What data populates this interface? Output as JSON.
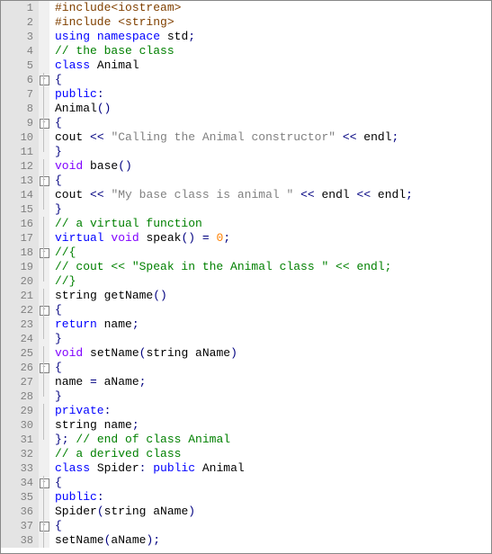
{
  "lines": [
    {
      "n": 1,
      "fold": "",
      "tokens": [
        [
          "preproc",
          "#include<iostream>"
        ]
      ]
    },
    {
      "n": 2,
      "fold": "",
      "tokens": [
        [
          "preproc",
          "#include <string>"
        ]
      ]
    },
    {
      "n": 3,
      "fold": "",
      "tokens": [
        [
          "keyword",
          "using"
        ],
        [
          "plain",
          " "
        ],
        [
          "keyword",
          "namespace"
        ],
        [
          "plain",
          " std"
        ],
        [
          "punct",
          ";"
        ]
      ]
    },
    {
      "n": 4,
      "fold": "",
      "tokens": [
        [
          "comment",
          "// the base class"
        ]
      ]
    },
    {
      "n": 5,
      "fold": "",
      "tokens": [
        [
          "keyword",
          "class"
        ],
        [
          "plain",
          " Animal"
        ]
      ]
    },
    {
      "n": 6,
      "fold": "box",
      "tokens": [
        [
          "punct",
          "{"
        ]
      ]
    },
    {
      "n": 7,
      "fold": "line",
      "tokens": [
        [
          "keyword",
          "public"
        ],
        [
          "punct",
          ":"
        ]
      ]
    },
    {
      "n": 8,
      "fold": "line",
      "tokens": [
        [
          "plain",
          "Animal"
        ],
        [
          "punct",
          "()"
        ]
      ]
    },
    {
      "n": 9,
      "fold": "box",
      "tokens": [
        [
          "punct",
          "{"
        ]
      ]
    },
    {
      "n": 10,
      "fold": "line",
      "tokens": [
        [
          "plain",
          "cout "
        ],
        [
          "punct",
          "<<"
        ],
        [
          "plain",
          " "
        ],
        [
          "string",
          "\"Calling the Animal constructor\""
        ],
        [
          "plain",
          " "
        ],
        [
          "punct",
          "<<"
        ],
        [
          "plain",
          " endl"
        ],
        [
          "punct",
          ";"
        ]
      ]
    },
    {
      "n": 11,
      "fold": "end",
      "tokens": [
        [
          "punct",
          "}"
        ]
      ]
    },
    {
      "n": 12,
      "fold": "line",
      "tokens": [
        [
          "type",
          "void"
        ],
        [
          "plain",
          " base"
        ],
        [
          "punct",
          "()"
        ]
      ]
    },
    {
      "n": 13,
      "fold": "box",
      "tokens": [
        [
          "punct",
          "{"
        ]
      ]
    },
    {
      "n": 14,
      "fold": "line",
      "tokens": [
        [
          "plain",
          "cout "
        ],
        [
          "punct",
          "<<"
        ],
        [
          "plain",
          " "
        ],
        [
          "string",
          "\"My base class is animal \""
        ],
        [
          "plain",
          " "
        ],
        [
          "punct",
          "<<"
        ],
        [
          "plain",
          " endl "
        ],
        [
          "punct",
          "<<"
        ],
        [
          "plain",
          " endl"
        ],
        [
          "punct",
          ";"
        ]
      ]
    },
    {
      "n": 15,
      "fold": "end",
      "tokens": [
        [
          "punct",
          "}"
        ]
      ]
    },
    {
      "n": 16,
      "fold": "line",
      "tokens": [
        [
          "comment",
          "// a virtual function"
        ]
      ]
    },
    {
      "n": 17,
      "fold": "line",
      "tokens": [
        [
          "keyword",
          "virtual"
        ],
        [
          "plain",
          " "
        ],
        [
          "type",
          "void"
        ],
        [
          "plain",
          " speak"
        ],
        [
          "punct",
          "()"
        ],
        [
          "plain",
          " "
        ],
        [
          "punct",
          "="
        ],
        [
          "plain",
          " "
        ],
        [
          "number",
          "0"
        ],
        [
          "punct",
          ";"
        ]
      ]
    },
    {
      "n": 18,
      "fold": "box",
      "tokens": [
        [
          "comment",
          "//{"
        ]
      ]
    },
    {
      "n": 19,
      "fold": "line",
      "tokens": [
        [
          "comment",
          "// cout << \"Speak in the Animal class \" << endl;"
        ]
      ]
    },
    {
      "n": 20,
      "fold": "end",
      "tokens": [
        [
          "comment",
          "//}"
        ]
      ]
    },
    {
      "n": 21,
      "fold": "line",
      "tokens": [
        [
          "plain",
          "string getName"
        ],
        [
          "punct",
          "()"
        ]
      ]
    },
    {
      "n": 22,
      "fold": "box",
      "tokens": [
        [
          "punct",
          "{"
        ]
      ]
    },
    {
      "n": 23,
      "fold": "line",
      "tokens": [
        [
          "keyword",
          "return"
        ],
        [
          "plain",
          " name"
        ],
        [
          "punct",
          ";"
        ]
      ]
    },
    {
      "n": 24,
      "fold": "end",
      "tokens": [
        [
          "punct",
          "}"
        ]
      ]
    },
    {
      "n": 25,
      "fold": "line",
      "tokens": [
        [
          "type",
          "void"
        ],
        [
          "plain",
          " setName"
        ],
        [
          "punct",
          "("
        ],
        [
          "plain",
          "string aName"
        ],
        [
          "punct",
          ")"
        ]
      ]
    },
    {
      "n": 26,
      "fold": "box",
      "tokens": [
        [
          "punct",
          "{"
        ]
      ]
    },
    {
      "n": 27,
      "fold": "line",
      "tokens": [
        [
          "plain",
          "name "
        ],
        [
          "punct",
          "="
        ],
        [
          "plain",
          " aName"
        ],
        [
          "punct",
          ";"
        ]
      ]
    },
    {
      "n": 28,
      "fold": "end",
      "tokens": [
        [
          "punct",
          "}"
        ]
      ]
    },
    {
      "n": 29,
      "fold": "line",
      "tokens": [
        [
          "keyword",
          "private"
        ],
        [
          "punct",
          ":"
        ]
      ]
    },
    {
      "n": 30,
      "fold": "line",
      "tokens": [
        [
          "plain",
          "string name"
        ],
        [
          "punct",
          ";"
        ]
      ]
    },
    {
      "n": 31,
      "fold": "end",
      "tokens": [
        [
          "punct",
          "};"
        ],
        [
          "plain",
          " "
        ],
        [
          "comment",
          "// end of class Animal"
        ]
      ]
    },
    {
      "n": 32,
      "fold": "",
      "tokens": [
        [
          "comment",
          "// a derived class"
        ]
      ]
    },
    {
      "n": 33,
      "fold": "",
      "tokens": [
        [
          "keyword",
          "class"
        ],
        [
          "plain",
          " Spider"
        ],
        [
          "punct",
          ":"
        ],
        [
          "plain",
          " "
        ],
        [
          "keyword",
          "public"
        ],
        [
          "plain",
          " Animal"
        ]
      ]
    },
    {
      "n": 34,
      "fold": "box",
      "tokens": [
        [
          "punct",
          "{"
        ]
      ]
    },
    {
      "n": 35,
      "fold": "line",
      "tokens": [
        [
          "keyword",
          "public"
        ],
        [
          "punct",
          ":"
        ]
      ]
    },
    {
      "n": 36,
      "fold": "line",
      "tokens": [
        [
          "plain",
          "Spider"
        ],
        [
          "punct",
          "("
        ],
        [
          "plain",
          "string aName"
        ],
        [
          "punct",
          ")"
        ]
      ]
    },
    {
      "n": 37,
      "fold": "box",
      "tokens": [
        [
          "punct",
          "{"
        ]
      ]
    },
    {
      "n": 38,
      "fold": "line",
      "tokens": [
        [
          "plain",
          "setName"
        ],
        [
          "punct",
          "("
        ],
        [
          "plain",
          "aName"
        ],
        [
          "punct",
          ");"
        ]
      ]
    }
  ]
}
